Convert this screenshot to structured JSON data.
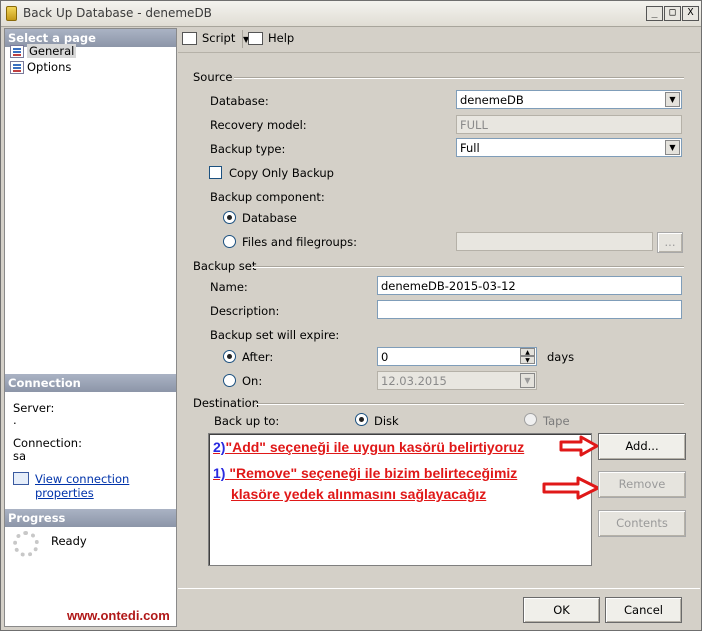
{
  "window": {
    "title": "Back Up Database - denemeDB",
    "controls": [
      "_",
      "□",
      "X"
    ]
  },
  "left_pane": {
    "select_header": "Select a page",
    "pages": [
      {
        "label": "General",
        "icon": "page-icon",
        "selected": true
      },
      {
        "label": "Options",
        "icon": "page-icon",
        "selected": false
      }
    ],
    "connection_header": "Connection",
    "server_label": "Server:",
    "server_value": ".",
    "connection_label": "Connection:",
    "connection_value": "sa",
    "view_link": "View connection properties",
    "progress_header": "Progress",
    "progress_status": "Ready"
  },
  "toolbar": {
    "script_label": "Script",
    "help_label": "Help"
  },
  "source": {
    "group_label": "Source",
    "database_label": "Database:",
    "database_value": "denemeDB",
    "recovery_label": "Recovery model:",
    "recovery_value": "FULL",
    "backup_type_label": "Backup type:",
    "backup_type_value": "Full",
    "copy_only_label": "Copy Only Backup",
    "copy_only_checked": false,
    "component_label": "Backup component:",
    "component_database": "Database",
    "component_files": "Files and filegroups:",
    "browse_label": "..."
  },
  "backup_set": {
    "group_label": "Backup set",
    "name_label": "Name:",
    "name_value": "denemeDB-2015-03-12",
    "description_label": "Description:",
    "description_value": "",
    "expire_label": "Backup set will expire:",
    "after_label": "After:",
    "after_value": "0",
    "days_label": "days",
    "on_label": "On:",
    "on_value": "12.03.2015"
  },
  "destination": {
    "group_label": "Destination",
    "backup_to_label": "Back up to:",
    "disk_label": "Disk",
    "tape_label": "Tape",
    "add_label": "Add...",
    "remove_label": "Remove",
    "contents_label": "Contents"
  },
  "annotations": {
    "line1_num": "2)",
    "line1_text": "\"Add\" seçeneği ile uygun kasörü belirtiyoruz",
    "line2_num": "1)",
    "line2_text": "\"Remove\" seçeneği ile bizim belirteceğimiz",
    "line3_text": "klasöre yedek alınmasını sağlayacağız",
    "color": "#e01818"
  },
  "footer": {
    "ok_label": "OK",
    "cancel_label": "Cancel",
    "watermark": "www.ontedi.com"
  }
}
